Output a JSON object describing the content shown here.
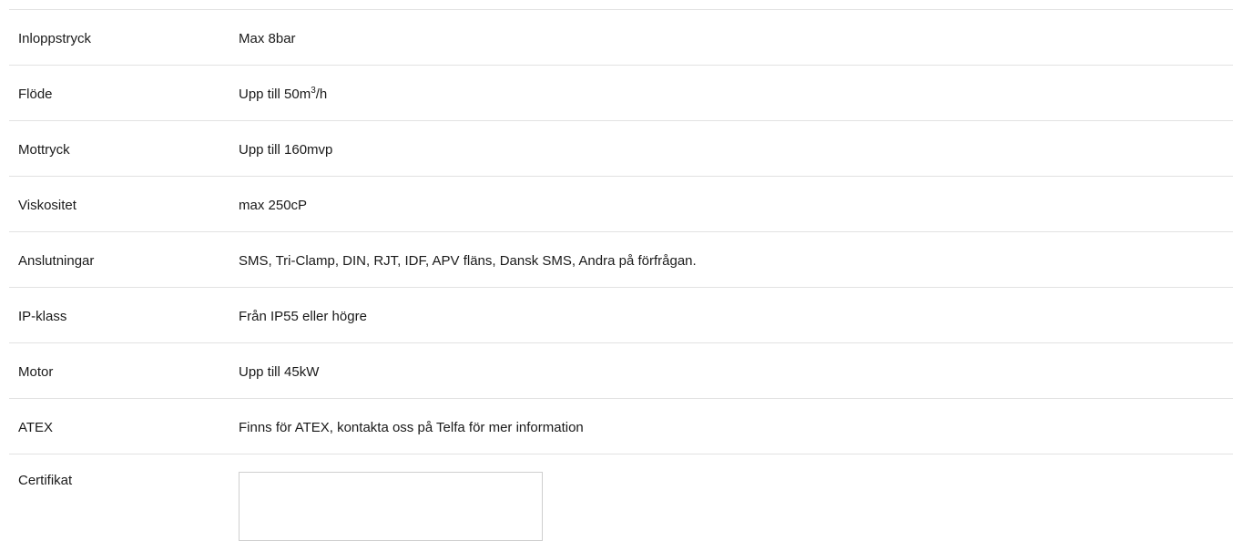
{
  "specs": [
    {
      "label": "Inloppstryck",
      "value": "Max 8bar"
    },
    {
      "label": "Flöde",
      "value_prefix": "Upp till 50m",
      "value_sup": "3",
      "value_suffix": "/h"
    },
    {
      "label": "Mottryck",
      "value": "Upp till 160mvp"
    },
    {
      "label": "Viskositet",
      "value": "max 250cP"
    },
    {
      "label": "Anslutningar",
      "value": "SMS, Tri-Clamp, DIN, RJT, IDF, APV fläns, Dansk SMS, Andra på förfrågan."
    },
    {
      "label": "IP-klass",
      "value": "Från IP55 eller högre"
    },
    {
      "label": "Motor",
      "value": "Upp till 45kW"
    },
    {
      "label": "ATEX",
      "value": "Finns för ATEX, kontakta oss på Telfa för mer information"
    },
    {
      "label": "Certifikat",
      "value": ""
    }
  ]
}
